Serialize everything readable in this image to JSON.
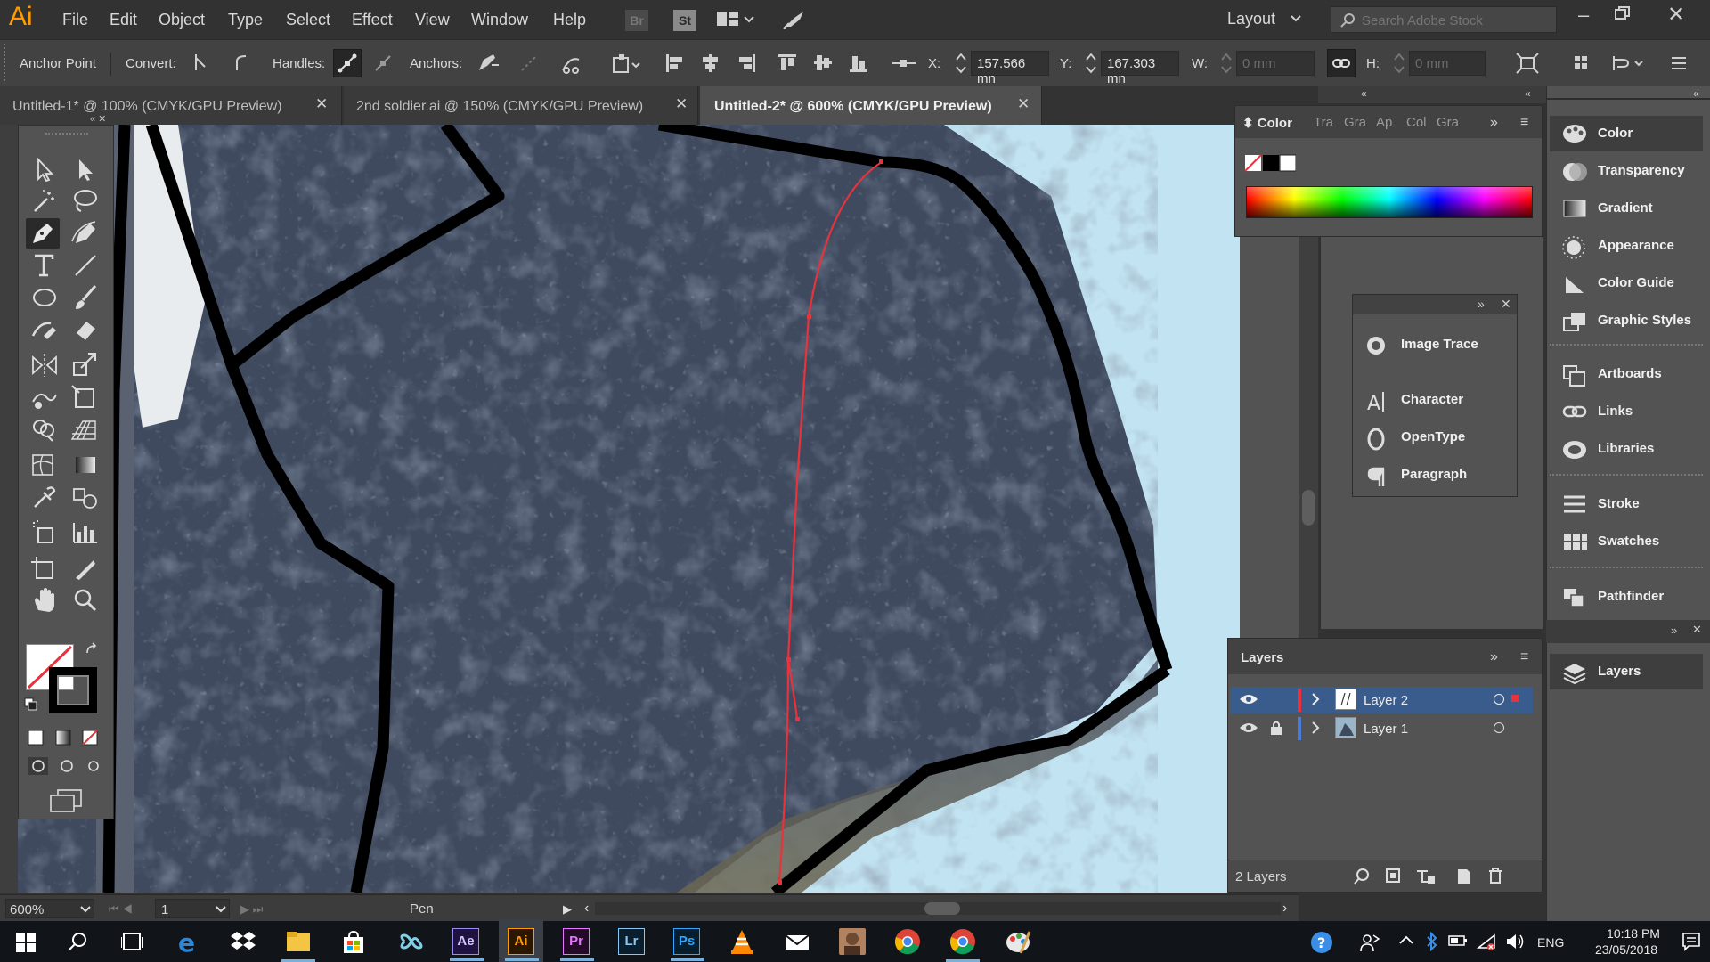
{
  "app": {
    "logo": "Ai",
    "menus": [
      "File",
      "Edit",
      "Object",
      "Type",
      "Select",
      "Effect",
      "View",
      "Window",
      "Help"
    ],
    "bridge_label": "Br",
    "stock_label": "St",
    "workspace": "Layout",
    "search_placeholder": "Search Adobe Stock"
  },
  "control_bar": {
    "selection_label": "Anchor Point",
    "convert_label": "Convert:",
    "handles_label": "Handles:",
    "anchors_label": "Anchors:",
    "x_label": "X:",
    "x_value": "157.566 mn",
    "y_label": "Y:",
    "y_value": "167.303 mn",
    "w_label": "W:",
    "w_value": "0 mm",
    "h_label": "H:",
    "h_value": "0 mm"
  },
  "tabs": [
    {
      "label": "Untitled-1* @ 100% (CMYK/GPU Preview)",
      "active": false
    },
    {
      "label": "2nd soldier.ai @ 150% (CMYK/GPU Preview)",
      "active": false
    },
    {
      "label": "Untitled-2* @ 600% (CMYK/GPU Preview)",
      "active": true
    }
  ],
  "status_bar": {
    "zoom": "600%",
    "artboard": "1",
    "tool": "Pen"
  },
  "color_panel": {
    "tabs": [
      "Color",
      "Tra",
      "Gra",
      "Ap",
      "Col",
      "Gra"
    ]
  },
  "floating_panel": {
    "items": [
      "Image Trace",
      "Character",
      "OpenType",
      "Paragraph"
    ]
  },
  "dock": {
    "group1": [
      "Color",
      "Transparency",
      "Gradient",
      "Appearance",
      "Color Guide",
      "Graphic Styles"
    ],
    "group2": [
      "Artboards",
      "Links",
      "Libraries"
    ],
    "group3": [
      "Stroke",
      "Swatches"
    ],
    "group4": [
      "Pathfinder"
    ],
    "group5": [
      "Layers"
    ]
  },
  "layers_panel": {
    "title": "Layers",
    "layers": [
      {
        "name": "Layer 2",
        "color": "#e8323c",
        "selected": true,
        "locked": false
      },
      {
        "name": "Layer 1",
        "color": "#4a7bd8",
        "selected": false,
        "locked": true
      }
    ],
    "count": "2 Layers"
  },
  "taskbar": {
    "language": "ENG",
    "time": "10:18 PM",
    "date": "23/05/2018"
  },
  "colors": {
    "ai_orange": "#ff9a00",
    "path_red": "#e8323c",
    "canvas_sky": "#c2e4f2"
  }
}
